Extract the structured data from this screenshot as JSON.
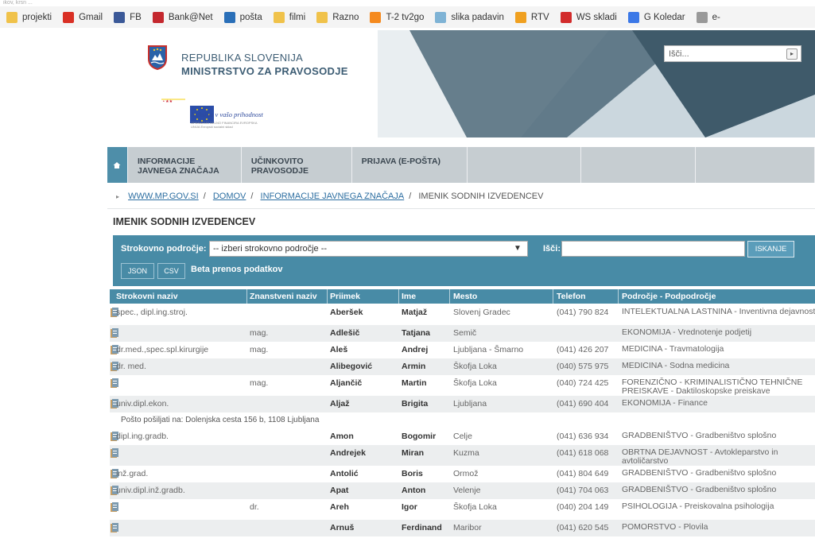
{
  "browser": {
    "topstrip_text": "ikov, krsn ...",
    "bookmarks": [
      {
        "label": "projekti",
        "icon": "folder-icon",
        "color": "#f0c24a"
      },
      {
        "label": "Gmail",
        "icon": "gmail-icon",
        "color": "#d93025"
      },
      {
        "label": "FB",
        "icon": "facebook-icon",
        "color": "#3b5998"
      },
      {
        "label": "Bank@Net",
        "icon": "bank-icon",
        "color": "#c4282e"
      },
      {
        "label": "pošta",
        "icon": "mail-icon",
        "color": "#2a6fb8"
      },
      {
        "label": "filmi",
        "icon": "folder-icon",
        "color": "#f0c24a"
      },
      {
        "label": "Razno",
        "icon": "folder-icon",
        "color": "#f0c24a"
      },
      {
        "label": "T-2 tv2go",
        "icon": "tv-icon",
        "color": "#f58a1f"
      },
      {
        "label": "slika padavin",
        "icon": "weather-icon",
        "color": "#7fb3d5"
      },
      {
        "label": "RTV",
        "icon": "rtv-icon",
        "color": "#f0a020"
      },
      {
        "label": "WS skladi",
        "icon": "ws-icon",
        "color": "#d22b2b"
      },
      {
        "label": "G Koledar",
        "icon": "calendar-icon",
        "color": "#3b78e7"
      },
      {
        "label": "e-",
        "icon": "page-icon",
        "color": "#999999"
      }
    ]
  },
  "header": {
    "republika": "REPUBLIKA SLOVENIJA",
    "ministrstvo": "MINISTRSTVO ZA PRAVOSODJE",
    "eu_slogan": "Naložba v vašo prihodnost",
    "eu_small": "OPERACIJO DELNO FINANCIRA EVROPSKA UNIJA Evropski socialni sklad",
    "search_placeholder": "Išči..."
  },
  "nav": {
    "items": [
      {
        "line1": "INFORMACIJE",
        "line2": "JAVNEGA ZNAČAJA"
      },
      {
        "line1": "UČINKOVITO",
        "line2": "PRAVOSODJE"
      },
      {
        "line1": "PRIJAVA (E-POŠTA)",
        "line2": ""
      },
      {
        "line1": "",
        "line2": ""
      },
      {
        "line1": "",
        "line2": ""
      },
      {
        "line1": "",
        "line2": ""
      }
    ]
  },
  "breadcrumb": [
    "WWW.MP.GOV.SI",
    "DOMOV",
    "INFORMACIJE JAVNEGA ZNAČAJA",
    "IMENIK SODNIH IZVEDENCEV"
  ],
  "page_title": "IMENIK SODNIH IZVEDENCEV",
  "filter": {
    "field_label": "Strokovno področje:",
    "field_value": "-- izberi strokovno področje --",
    "search_label": "Išči:",
    "search_value": "",
    "search_button": "ISKANJE",
    "json_button": "JSON",
    "csv_button": "CSV",
    "beta_text": "Beta prenos podatkov"
  },
  "table": {
    "columns": [
      "Strokovni naziv",
      "Znanstveni naziv",
      "Priimek",
      "Ime",
      "Mesto",
      "Telefon",
      "Področje - Podpodročje"
    ],
    "rows": [
      {
        "naziv": "spec., dipl.ing.stroj.",
        "znanstveni": "",
        "priimek": "Aberšek",
        "ime": "Matjaž",
        "mesto": "Slovenj Gradec",
        "telefon": "(041) 790 824",
        "podrocje": "INTELEKTUALNA LASTNINA - Inventivna dejavnost"
      },
      {
        "naziv": "",
        "znanstveni": "mag.",
        "priimek": "Adlešič",
        "ime": "Tatjana",
        "mesto": "Semič",
        "telefon": "",
        "podrocje": "EKONOMIJA - Vrednotenje podjetij"
      },
      {
        "naziv": "dr.med.,spec.spl.kirurgije",
        "znanstveni": "mag.",
        "priimek": "Aleš",
        "ime": "Andrej",
        "mesto": "Ljubljana - Šmarno",
        "telefon": "(041) 426 207",
        "podrocje": "MEDICINA - Travmatologija"
      },
      {
        "naziv": "dr. med.",
        "znanstveni": "",
        "priimek": "Alibegović",
        "ime": "Armin",
        "mesto": "Škofja Loka",
        "telefon": "(040) 575 975",
        "podrocje": "MEDICINA - Sodna medicina"
      },
      {
        "naziv": "",
        "znanstveni": "mag.",
        "priimek": "Aljančič",
        "ime": "Martin",
        "mesto": "Škofja Loka",
        "telefon": "(040) 724 425",
        "podrocje": "FORENZIČNO - KRIMINALISTIČNO TEHNIČNE PREISKAVE - Daktiloskopske preiskave"
      },
      {
        "naziv": "univ.dipl.ekon.",
        "znanstveni": "",
        "priimek": "Aljaž",
        "ime": "Brigita",
        "mesto": "Ljubljana",
        "telefon": "(041) 690 404",
        "podrocje": "EKONOMIJA - Finance",
        "note": "Pošto pošiljati na: Dolenjska cesta 156 b, 1108 Ljubljana"
      },
      {
        "naziv": "dipl.ing.gradb.",
        "znanstveni": "",
        "priimek": "Amon",
        "ime": "Bogomir",
        "mesto": "Celje",
        "telefon": "(041) 636 934",
        "podrocje": "GRADBENIŠTVO - Gradbeništvo splošno"
      },
      {
        "naziv": "",
        "znanstveni": "",
        "priimek": "Andrejek",
        "ime": "Miran",
        "mesto": "Kuzma",
        "telefon": "(041) 618 068",
        "podrocje": "OBRTNA DEJAVNOST - Avtokleparstvo in avtoličarstvo"
      },
      {
        "naziv": "inž.grad.",
        "znanstveni": "",
        "priimek": "Antolić",
        "ime": "Boris",
        "mesto": "Ormož",
        "telefon": "(041) 804 649",
        "podrocje": "GRADBENIŠTVO - Gradbeništvo splošno"
      },
      {
        "naziv": "univ.dipl.inž.gradb.",
        "znanstveni": "",
        "priimek": "Apat",
        "ime": "Anton",
        "mesto": "Velenje",
        "telefon": "(041) 704 063",
        "podrocje": "GRADBENIŠTVO - Gradbeništvo splošno"
      },
      {
        "naziv": "",
        "znanstveni": "dr.",
        "priimek": "Areh",
        "ime": "Igor",
        "mesto": "Škofja Loka",
        "telefon": "(040) 204 149",
        "podrocje": "PSIHOLOGIJA - Preiskovalna psihologija"
      },
      {
        "naziv": "",
        "znanstveni": "",
        "priimek": "Arnuš",
        "ime": "Ferdinand",
        "mesto": "Maribor",
        "telefon": "(041) 620 545",
        "podrocje": "POMORSTVO - Plovila"
      }
    ]
  },
  "colors": {
    "accent": "#488ba6",
    "nav_bg": "#c6cdd1",
    "link": "#2c6ea1",
    "home": "#4e8ea9"
  }
}
